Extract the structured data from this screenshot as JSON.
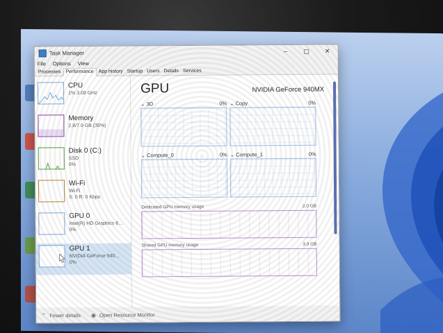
{
  "window": {
    "title": "Task Manager",
    "controls": {
      "minimize": "–",
      "maximize": "▢",
      "close": "✕"
    }
  },
  "menu": {
    "items": [
      "File",
      "Options",
      "View"
    ]
  },
  "tabs": [
    "Processes",
    "Performance",
    "App history",
    "Startup",
    "Users",
    "Details",
    "Services"
  ],
  "active_tab": "Performance",
  "sidebar": {
    "items": [
      {
        "name": "CPU",
        "sub1": "1% 3.09 GHz",
        "sub2": "",
        "kind": "cpu"
      },
      {
        "name": "Memory",
        "sub1": "2.8/7.9 GB (35%)",
        "sub2": "",
        "kind": "mem"
      },
      {
        "name": "Disk 0 (C:)",
        "sub1": "SSD",
        "sub2": "0%",
        "kind": "disk"
      },
      {
        "name": "Wi-Fi",
        "sub1": "Wi-Fi",
        "sub2": "S: 0 R: 0 Kbps",
        "kind": "net"
      },
      {
        "name": "GPU 0",
        "sub1": "Intel(R) HD Graphics 6...",
        "sub2": "0%",
        "kind": "gpu"
      },
      {
        "name": "GPU 1",
        "sub1": "NVIDIA GeForce 940...",
        "sub2": "0%",
        "kind": "gpu",
        "selected": true
      }
    ]
  },
  "main": {
    "title": "GPU",
    "model": "NVIDIA GeForce 940MX",
    "graphs": [
      {
        "label": "3D",
        "value": "0%"
      },
      {
        "label": "Copy",
        "value": "0%"
      },
      {
        "label": "Compute_0",
        "value": "0%"
      },
      {
        "label": "Compute_1",
        "value": "0%"
      }
    ],
    "dedicated": {
      "label": "Dedicated GPU memory usage",
      "max": "2.0 GB"
    },
    "shared": {
      "label": "Shared GPU memory usage",
      "max": "3.9 GB"
    }
  },
  "footer": {
    "fewer_details": "Fewer details",
    "resource_monitor": "Open Resource Monitor"
  },
  "colors": {
    "cpu": "#7aa6d6",
    "memory": "#8a3aa6",
    "disk": "#4d9a3a",
    "network": "#b5802a",
    "selected": "#d5e5f6",
    "wallpaper": "#5c86c8"
  }
}
